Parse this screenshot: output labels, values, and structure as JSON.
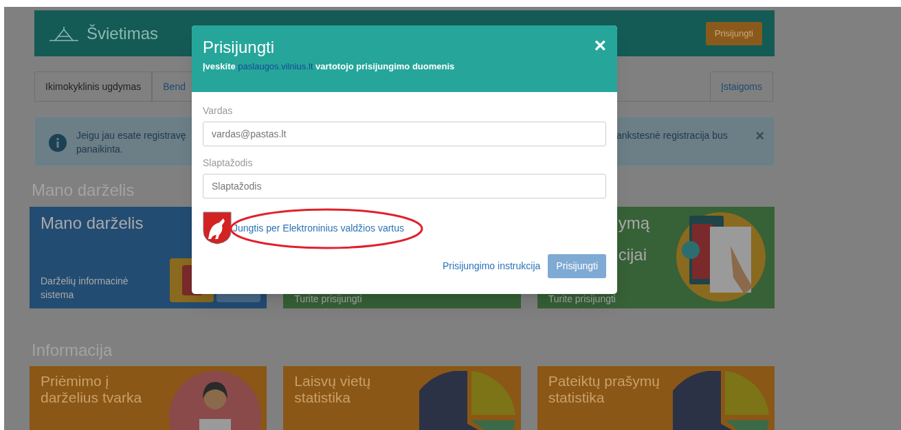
{
  "header": {
    "brand": "Švietimas",
    "login_button": "Prisijungti"
  },
  "tabs": [
    {
      "label": "Ikimokyklinis ugdymas",
      "selected": true
    },
    {
      "label": "Bend",
      "selected": false
    }
  ],
  "right_tab": {
    "label": "Įstaigoms",
    "selected": false
  },
  "alert": {
    "text_left": "Jeigu jau esate registravę",
    "text_right": "ankstesnė registracija bus",
    "text_line2": "panaikinta.",
    "close": "×"
  },
  "section1": {
    "heading": "Mano darželis",
    "cards": [
      {
        "kind": "blue",
        "title": "Mano darželis",
        "subtitle": "Darželių informacinė sistema"
      },
      {
        "kind": "green",
        "note": "Turite prisijungti"
      },
      {
        "kind": "green2",
        "title": "ymą",
        "title2": "cijai",
        "note": "Turite prisijungti"
      }
    ]
  },
  "section2": {
    "heading": "Informacija",
    "cards": [
      {
        "kind": "person",
        "title": "Priėmimo į darželius tvarka"
      },
      {
        "kind": "pie",
        "title": "Laisvų vietų statistika"
      },
      {
        "kind": "pie",
        "title": "Pateiktų prašymų statistika"
      }
    ]
  },
  "modal": {
    "title": "Prisijungti",
    "close": "×",
    "subtitle_before": "Įveskite",
    "subtitle_link": "paslaugos.vilnius.lt",
    "subtitle_after": "vartotojo prisijungimo duomenis",
    "fields": [
      {
        "label": "Vardas",
        "placeholder": "vardas@pastas.lt"
      },
      {
        "label": "Slaptažodis",
        "placeholder": "Slaptažodis"
      }
    ],
    "gateway_link": "Jungtis per Elektroninius valdžios vartus",
    "instructions_link": "Prisijungimo instrukcija",
    "submit": "Prisijungti",
    "submit_disabled": true
  }
}
